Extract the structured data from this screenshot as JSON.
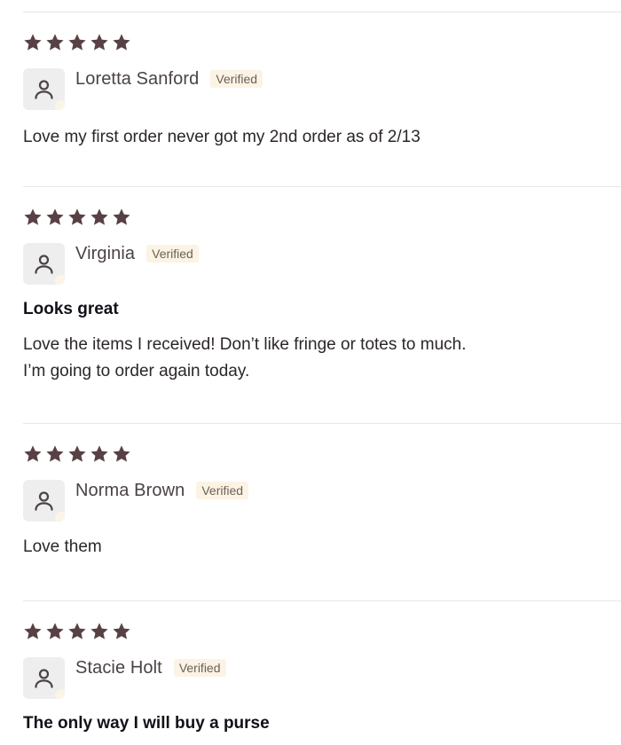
{
  "reviews": [
    {
      "author": "Loretta Sanford",
      "badge": "Verified",
      "rating": 5,
      "title": "",
      "body": [
        "Love my first order never got my 2nd order as of 2/13"
      ]
    },
    {
      "author": "Virginia",
      "badge": "Verified",
      "rating": 5,
      "title": "Looks great",
      "body": [
        "Love the items I received! Don’t like fringe or totes to much.",
        "I’m going to order again today."
      ]
    },
    {
      "author": "Norma Brown",
      "badge": "Verified",
      "rating": 5,
      "title": "",
      "body": [
        "Love them"
      ]
    },
    {
      "author": "Stacie Holt",
      "badge": "Verified",
      "rating": 5,
      "title": "The only way I will buy a purse",
      "body": []
    }
  ],
  "colors": {
    "star": "#574145",
    "badge_bg": "#fbf3e4",
    "avatar_bg": "#eeeeee",
    "avatar_icon": "#4b4448",
    "divider": "#e8e6e6"
  },
  "icons": {
    "rating_star": "star-icon",
    "avatar": "user-icon"
  }
}
